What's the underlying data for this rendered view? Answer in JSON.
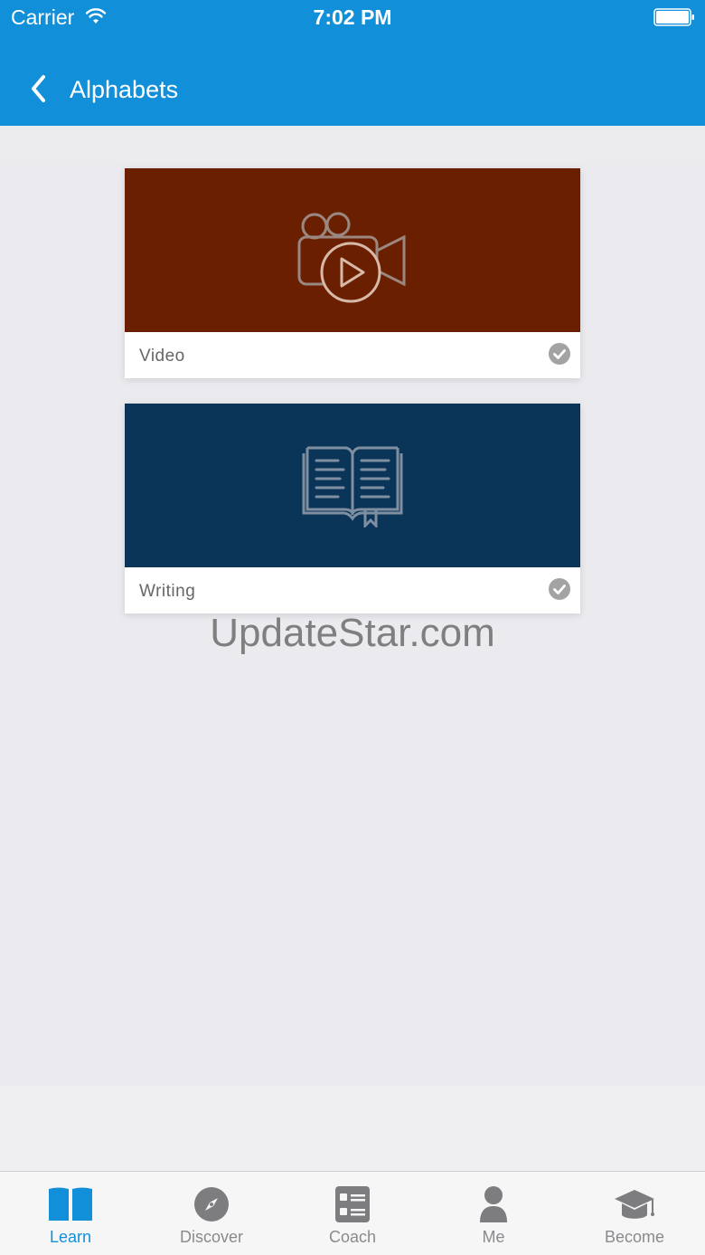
{
  "status_bar": {
    "carrier": "Carrier",
    "time": "7:02 PM"
  },
  "nav": {
    "title": "Alphabets"
  },
  "cards": [
    {
      "label": "Video",
      "bg_color": "#6a2000",
      "icon": "video-camera-icon",
      "completed": true
    },
    {
      "label": "Writing",
      "bg_color": "#0a3558",
      "icon": "open-book-icon",
      "completed": true
    }
  ],
  "watermark": "UpdateStar.com",
  "tabs": [
    {
      "label": "Learn",
      "icon": "book-icon",
      "active": true
    },
    {
      "label": "Discover",
      "icon": "compass-icon",
      "active": false
    },
    {
      "label": "Coach",
      "icon": "checklist-icon",
      "active": false
    },
    {
      "label": "Me",
      "icon": "person-icon",
      "active": false
    },
    {
      "label": "Become",
      "icon": "graduation-cap-icon",
      "active": false
    }
  ],
  "colors": {
    "accent": "#128fd9",
    "inactive_tab": "#8a8a8e",
    "check": "#a3a3a3"
  }
}
